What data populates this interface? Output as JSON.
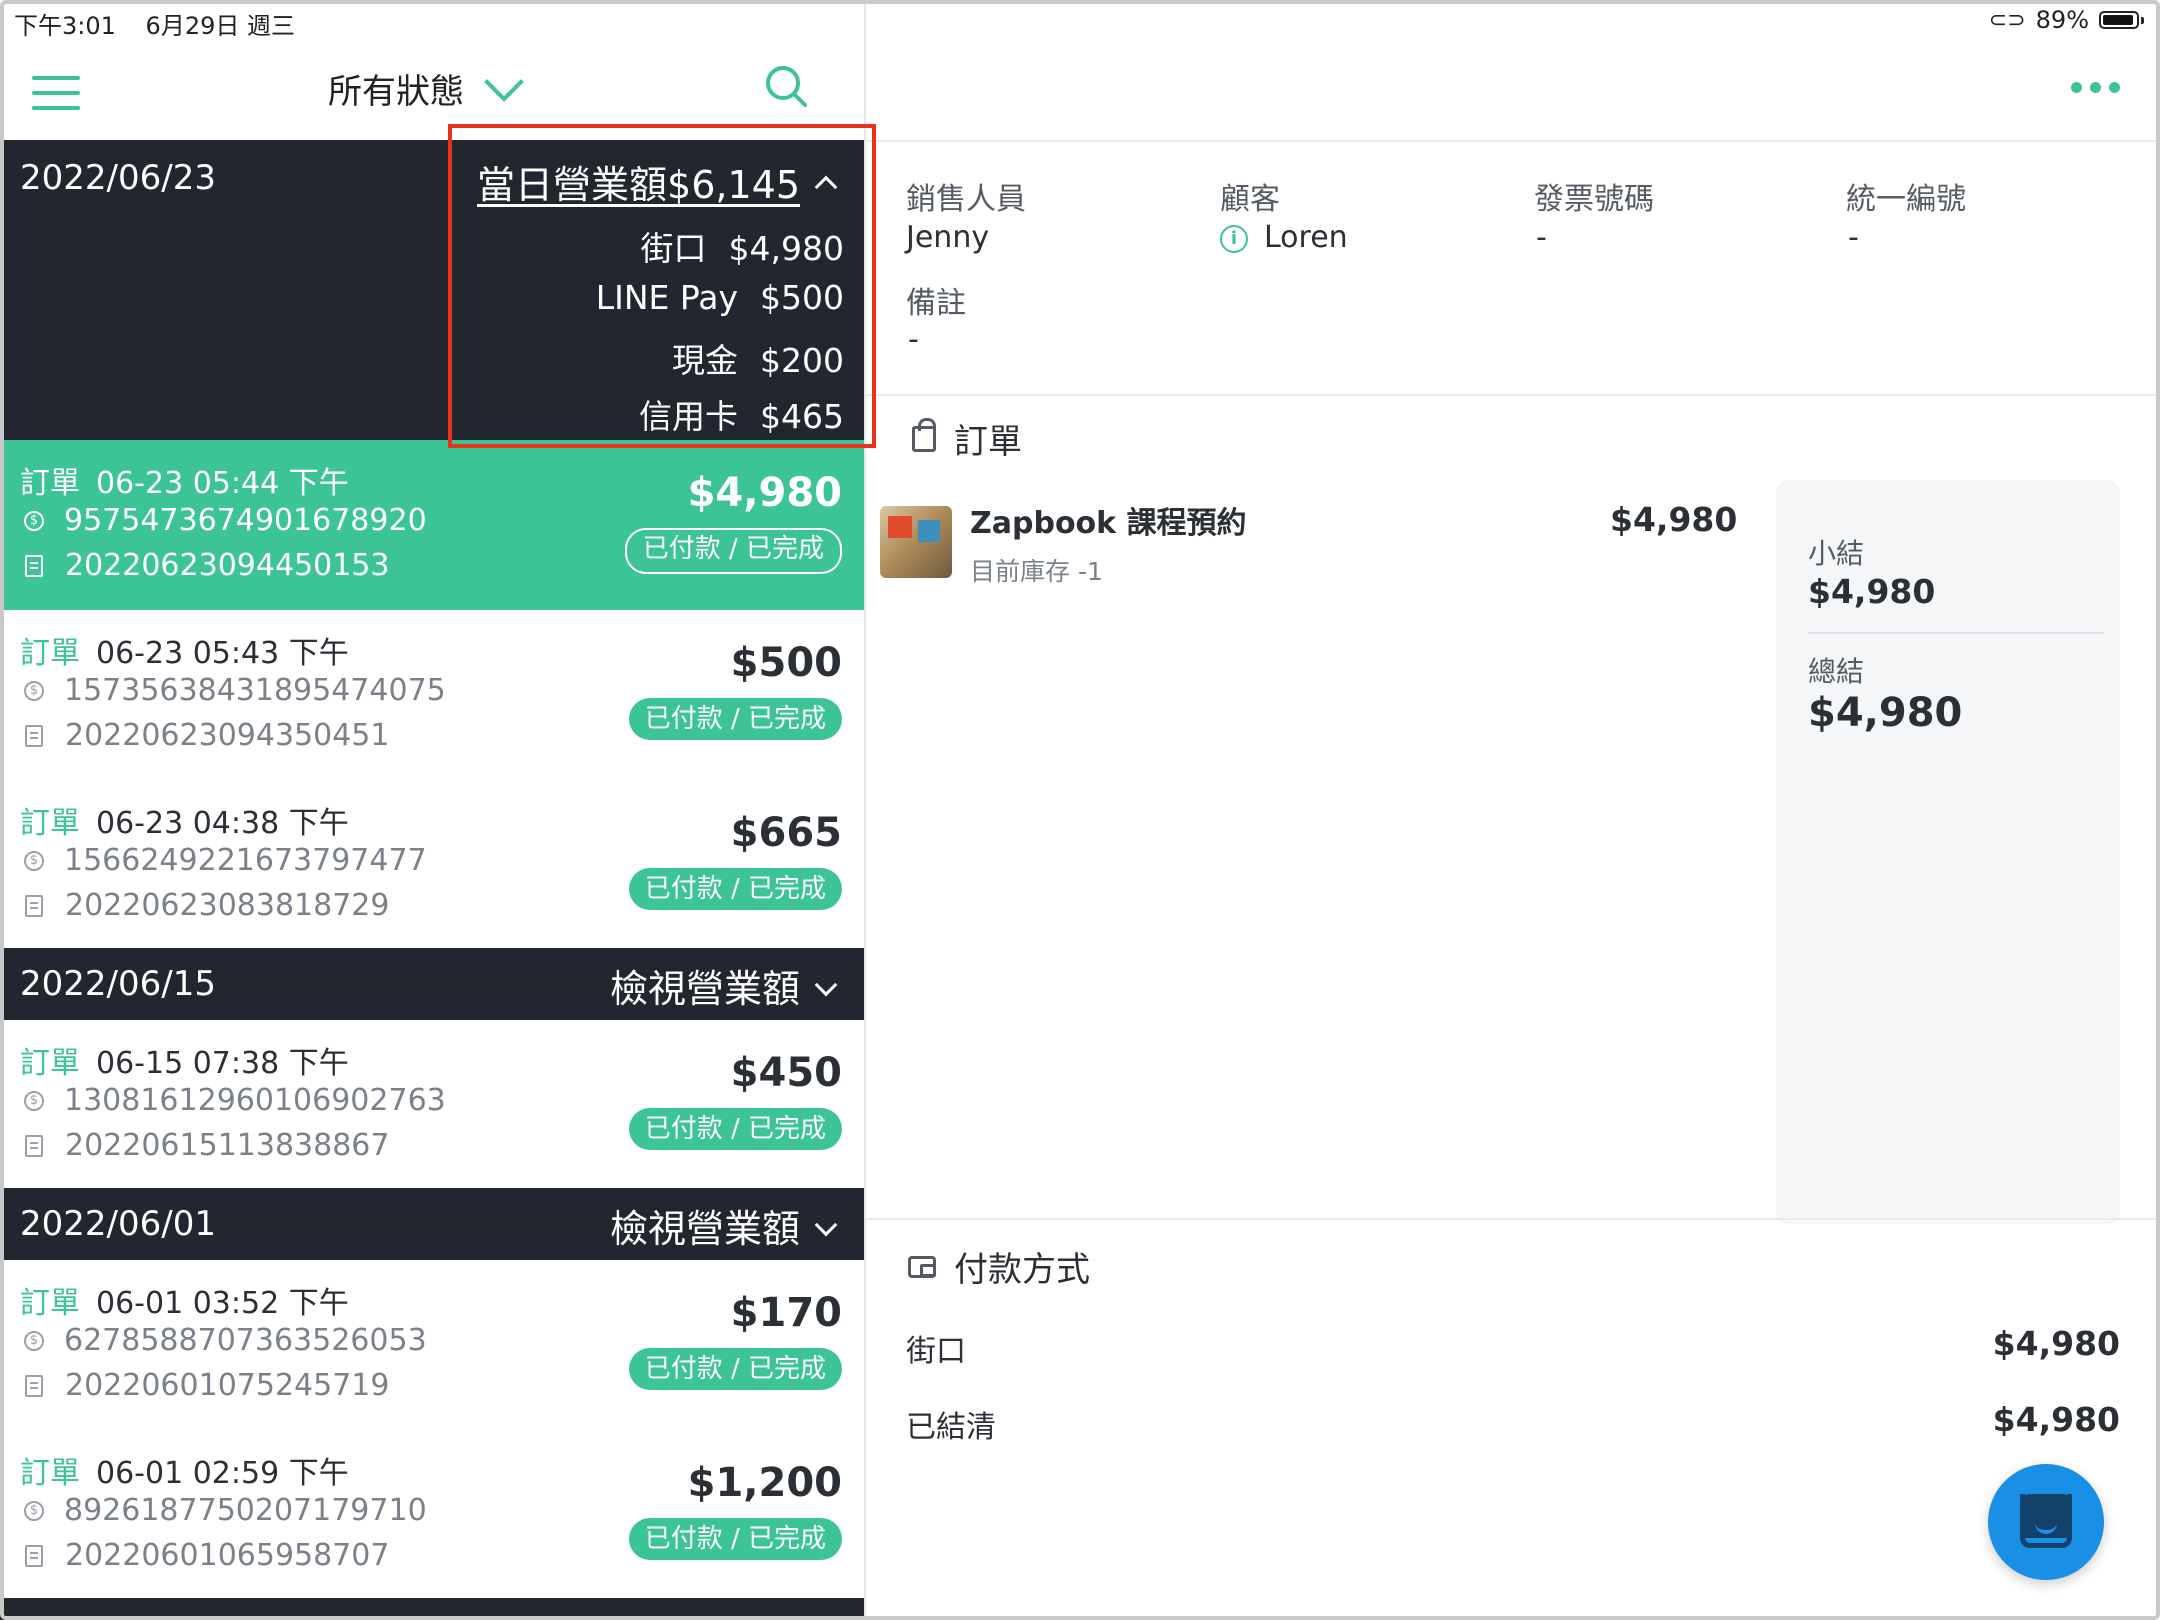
{
  "statusbar": {
    "time": "下午3:01",
    "date": "6月29日 週三",
    "battery": "89%"
  },
  "topbar": {
    "filter_label": "所有狀態"
  },
  "days": [
    {
      "date": "2022/06/23",
      "total_label": "當日營業額$6,145",
      "breakdown": [
        {
          "method": "街口",
          "amount": "$4,980"
        },
        {
          "method": "LINE Pay",
          "amount": "$500"
        },
        {
          "method": "現金",
          "amount": "$200"
        },
        {
          "method": "信用卡",
          "amount": "$465"
        }
      ]
    },
    {
      "date": "2022/06/15",
      "view_label": "檢視營業額"
    },
    {
      "date": "2022/06/01",
      "view_label": "檢視營業額"
    }
  ],
  "orders": [
    {
      "tag": "訂單",
      "time": "06-23 05:44 下午",
      "txn": "9575473674901678920",
      "receipt": "20220623094450153",
      "amount": "$4,980",
      "status": "已付款 / 已完成"
    },
    {
      "tag": "訂單",
      "time": "06-23 05:43 下午",
      "txn": "1573563843189547407​5",
      "receipt": "20220623094350451",
      "amount": "$500",
      "status": "已付款 / 已完成"
    },
    {
      "tag": "訂單",
      "time": "06-23 04:38 下午",
      "txn": "1566249221673797477",
      "receipt": "20220623083818729",
      "amount": "$665",
      "status": "已付款 / 已完成"
    },
    {
      "tag": "訂單",
      "time": "06-15 07:38 下午",
      "txn": "13081612960106902763",
      "receipt": "20220615113838867",
      "amount": "$450",
      "status": "已付款 / 已完成"
    },
    {
      "tag": "訂單",
      "time": "06-01 03:52 下午",
      "txn": "6278588707363526053",
      "receipt": "20220601075245719",
      "amount": "$170",
      "status": "已付款 / 已完成"
    },
    {
      "tag": "訂單",
      "time": "06-01 02:59 下午",
      "txn": "8926187750207179710",
      "receipt": "20220601065958707",
      "amount": "$1,200",
      "status": "已付款 / 已完成"
    }
  ],
  "detail": {
    "meta": [
      {
        "label": "銷售人員",
        "value": "Jenny"
      },
      {
        "label": "顧客",
        "value": "Loren"
      },
      {
        "label": "發票號碼",
        "value": "-"
      },
      {
        "label": "統一編號",
        "value": "-"
      },
      {
        "label": "備註",
        "value": "-"
      }
    ],
    "order_section_title": "訂單",
    "item": {
      "name": "Zapbook 課程預約",
      "stock": "目前庫存 -1",
      "price": "$4,980"
    },
    "summary": {
      "subtotal_label": "小結",
      "subtotal": "$4,980",
      "total_label": "總結",
      "total": "$4,980"
    },
    "payment_section_title": "付款方式",
    "payments": [
      {
        "label": "街口",
        "value": "$4,980"
      },
      {
        "label": "已結清",
        "value": "$4,980"
      }
    ]
  },
  "colors": {
    "accent": "#3cc494",
    "dark": "#22262e",
    "highlight": "#e8321c",
    "fab": "#1a8fe6"
  }
}
